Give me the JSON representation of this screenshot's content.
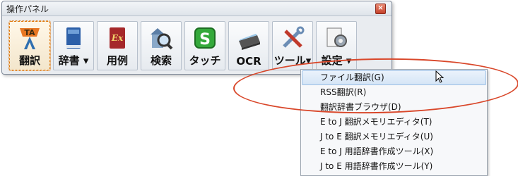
{
  "window": {
    "title": "操作パネル",
    "close_glyph": "×"
  },
  "toolbar": {
    "buttons": [
      {
        "label": "翻訳",
        "icon": "ta-translate-icon"
      },
      {
        "label": "辞書 ▾",
        "icon": "dictionary-book-icon"
      },
      {
        "label": "用例",
        "icon": "example-book-icon"
      },
      {
        "label": "検索",
        "icon": "search-magnifier-icon"
      },
      {
        "label": "タッチ",
        "icon": "touch-s-icon"
      },
      {
        "label": "OCR",
        "icon": "scanner-icon"
      },
      {
        "label": "ツール▾",
        "icon": "tools-icon"
      },
      {
        "label": "設定 ▾",
        "icon": "settings-icon"
      }
    ]
  },
  "menu": {
    "items": [
      "ファイル翻訳(G)",
      "RSS翻訳(R)",
      "翻訳辞書ブラウザ(D)",
      "E to J 翻訳メモリエディタ(T)",
      "J to E 翻訳メモリエディタ(U)",
      "E to J 用語辞書作成ツール(X)",
      "J to E 用語辞書作成ツール(Y)"
    ],
    "hovered_index": 0
  },
  "colors": {
    "highlight_oval": "#d9472a",
    "active_border": "#e07a10"
  }
}
